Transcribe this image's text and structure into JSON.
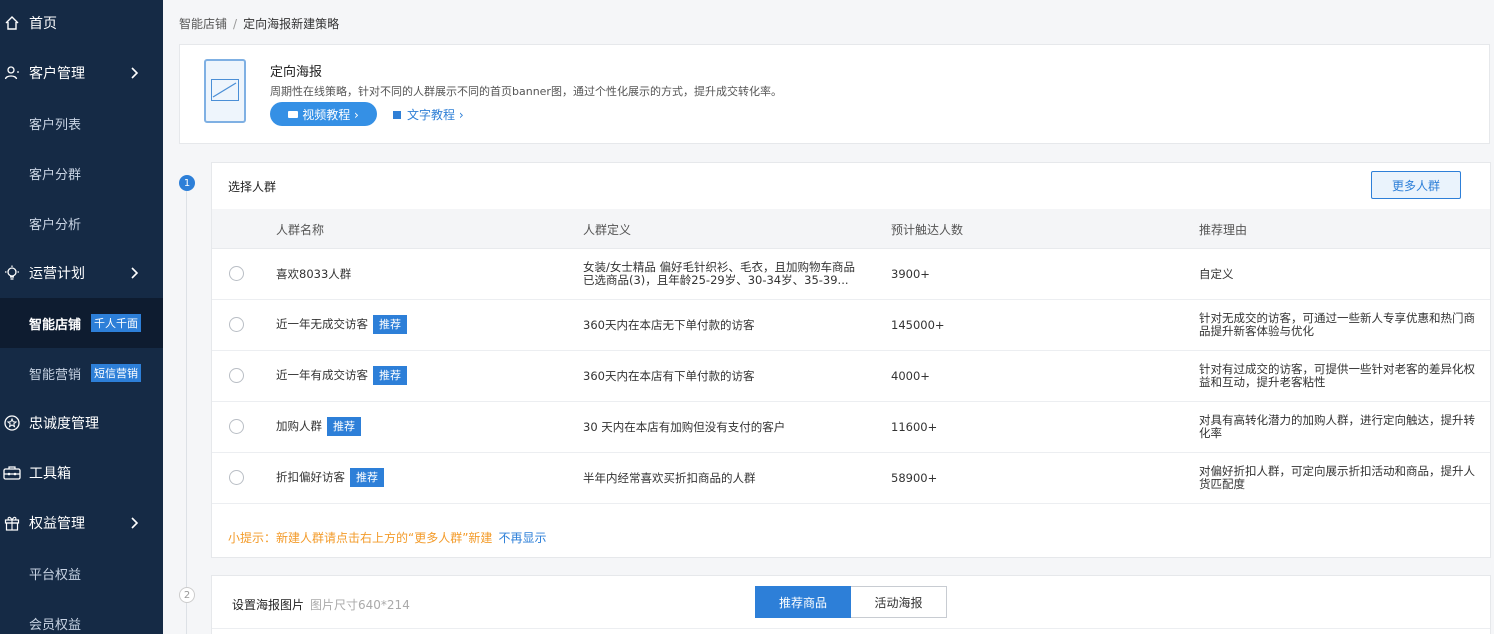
{
  "sidebar": {
    "home": "首页",
    "customer_mgmt": "客户管理",
    "customer_list": "客户列表",
    "customer_group": "客户分群",
    "customer_analysis": "客户分析",
    "ops_plan": "运营计划",
    "smart_store": "智能店铺",
    "smart_store_tag": "千人千面",
    "smart_marketing": "智能营销",
    "smart_marketing_tag": "短信营销",
    "loyalty": "忠诚度管理",
    "toolbox": "工具箱",
    "rights_mgmt": "权益管理",
    "platform_rights": "平台权益",
    "member_rights": "会员权益"
  },
  "breadcrumb": {
    "parent": "智能店铺",
    "sep": "/",
    "current": "定向海报新建策略"
  },
  "intro": {
    "title": "定向海报",
    "desc": "周期性在线策略，针对不同的人群展示不同的首页banner图，通过个性化展示的方式，提升成交转化率。",
    "video_btn": "视频教程 ›",
    "text_link": "文字教程 ›"
  },
  "steps": {
    "one": "1",
    "two": "2"
  },
  "crowd": {
    "title": "选择人群",
    "more_btn": "更多人群",
    "headers": {
      "name": "人群名称",
      "def": "人群定义",
      "reach": "预计触达人数",
      "reason": "推荐理由"
    },
    "rows": [
      {
        "name": "喜欢8033人群",
        "tag": "",
        "def": "女装/女士精品 偏好毛针织衫、毛衣，且加购物车商品已选商品(3)，且年龄25-29岁、30-34岁、35-39...",
        "reach": "3900+",
        "reason": "自定义"
      },
      {
        "name": "近一年无成交访客",
        "tag": "推荐",
        "def": "360天内在本店无下单付款的访客",
        "reach": "145000+",
        "reason": "针对无成交的访客，可通过一些新人专享优惠和热门商品提升新客体验与优化"
      },
      {
        "name": "近一年有成交访客",
        "tag": "推荐",
        "def": "360天内在本店有下单付款的访客",
        "reach": "4000+",
        "reason": "针对有过成交的访客，可提供一些针对老客的差异化权益和互动，提升老客粘性"
      },
      {
        "name": "加购人群",
        "tag": "推荐",
        "def": "30 天内在本店有加购但没有支付的客户",
        "reach": "11600+",
        "reason": "对具有高转化潜力的加购人群，进行定向触达，提升转化率"
      },
      {
        "name": "折扣偏好访客",
        "tag": "推荐",
        "def": "半年内经常喜欢买折扣商品的人群",
        "reach": "58900+",
        "reason": "对偏好折扣人群，可定向展示折扣活动和商品，提升人货匹配度"
      }
    ],
    "tip": "小提示：新建人群请点击右上方的“更多人群”新建",
    "tip_link": "不再显示"
  },
  "poster": {
    "title": "设置海报图片",
    "hint": "图片尺寸640*214",
    "tab_on": "推荐商品",
    "tab_off": "活动海报"
  }
}
